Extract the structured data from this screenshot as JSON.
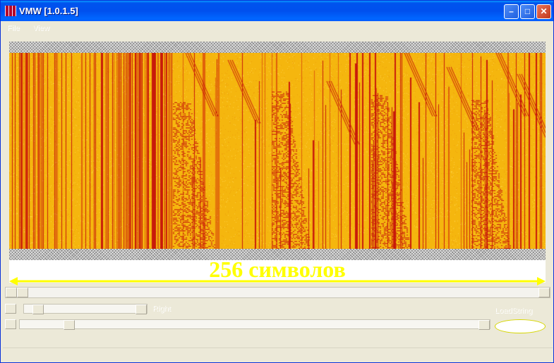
{
  "window": {
    "title": "VMW [1.0.1.5]"
  },
  "menu": {
    "items": [
      "File",
      "View"
    ]
  },
  "controls": {
    "right_label": "Right",
    "load_label": "LoadString"
  },
  "annotation": {
    "text": "256 символов"
  },
  "colors": {
    "accent": "#ffff00",
    "bar": "#c81a0a",
    "base": "#f5b60e"
  }
}
